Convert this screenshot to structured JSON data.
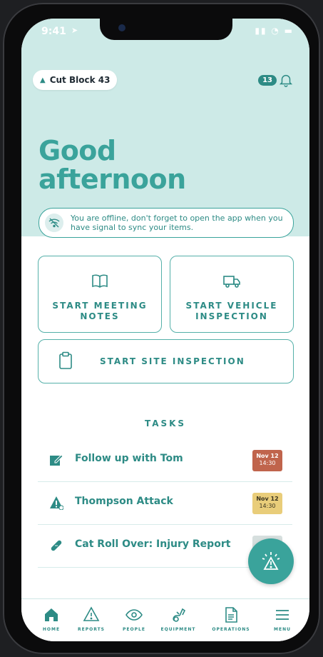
{
  "status_bar": {
    "time": "9:41",
    "location_arrow": "➤",
    "signal_wifi_battery": "▮▮ ◔ ▬"
  },
  "header": {
    "location_chip": "Cut Block 43",
    "notification_count": "13"
  },
  "greeting": {
    "line1": "Good",
    "line2": "afternoon"
  },
  "offline_banner": {
    "message": "You are offline, don't forget to open the app when you have signal to sync your items."
  },
  "actions": {
    "meeting": {
      "line1": "START MEETING",
      "line2": "NOTES"
    },
    "vehicle": {
      "line1": "START VEHICLE",
      "line2": "INSPECTION"
    },
    "site": "START SITE INSPECTION"
  },
  "tasks": {
    "title": "TASKS",
    "items": [
      {
        "name": "Follow up with Tom",
        "date": "Nov 12",
        "time": "14:30",
        "status_color": "#c0644c",
        "icon": "edit-icon"
      },
      {
        "name": "Thompson Attack",
        "date": "Nov 12",
        "time": "14:30",
        "status_color": "#e9cd7a",
        "icon": "warning-icon"
      },
      {
        "name": "Cat Roll Over: Injury Report",
        "date": "",
        "time": "",
        "status_color": "#d6dfde",
        "icon": "bandage-icon"
      }
    ]
  },
  "nav": {
    "home": "HOME",
    "reports": "REPORTS",
    "people": "PEOPLE",
    "equipment": "EQUIPMENT",
    "operations": "OPERATIONS",
    "menu": "MENU"
  },
  "colors": {
    "accent": "#3aa39b",
    "hero_bg": "#cdeae7",
    "dark_accent": "#2d8b85"
  }
}
